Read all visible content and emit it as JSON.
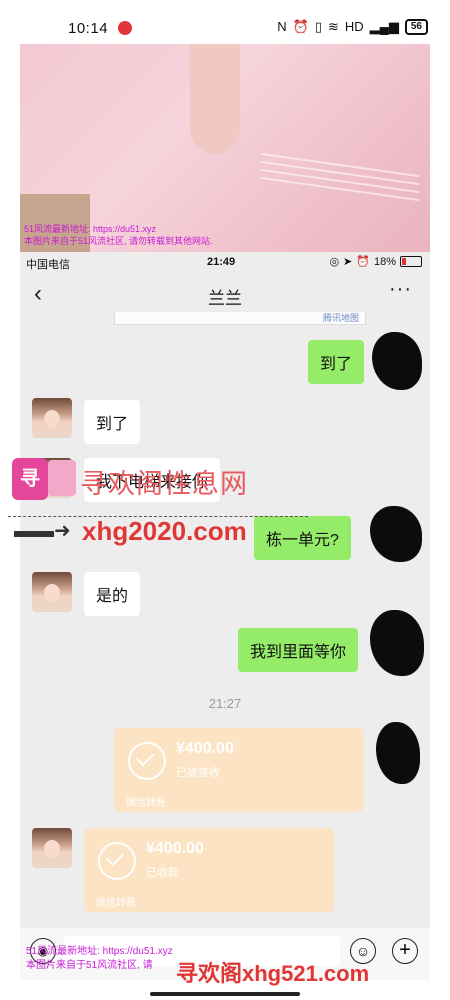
{
  "status_bar": {
    "time": "10:14",
    "battery": "56",
    "icons": [
      "nfc-icon",
      "alarm-icon",
      "vibrate-icon",
      "wifi-icon",
      "hd-icon",
      "signal-5g-icon"
    ]
  },
  "photo": {
    "watermark_line1": "51风流最新地址: https://du51.xyz",
    "watermark_line2": "本图片来自于51风流社区, 请勿转载到其他网站."
  },
  "inner_phone": {
    "status": {
      "carrier": "中国电信",
      "time": "21:49",
      "battery": "18%"
    },
    "nav": {
      "title": "兰兰"
    },
    "map_label": "腾讯地图",
    "messages": [
      {
        "side": "out",
        "text": "到了"
      },
      {
        "side": "in",
        "text": "到了"
      },
      {
        "side": "in",
        "text": "我下电梯来接你"
      },
      {
        "side": "out",
        "text": "栋一单元?"
      },
      {
        "side": "in",
        "text": "是的"
      },
      {
        "side": "out",
        "text": "我到里面等你"
      }
    ],
    "time_divider": "21:27",
    "transfers": [
      {
        "amount": "¥400.00",
        "status": "已被接收",
        "source": "微信转账"
      },
      {
        "amount": "¥400.00",
        "status": "已收款",
        "source": "微信转账"
      }
    ]
  },
  "watermark": {
    "logo_text": "寻",
    "site_name": "寻欢阁性息网",
    "site_url": "xhg2020.com",
    "bottom_line1": "51风流最新地址: https://du51.xyz",
    "bottom_line2": "本图片来自于51风流社区, 请",
    "bottom_big": "寻欢阁xhg521.com"
  }
}
